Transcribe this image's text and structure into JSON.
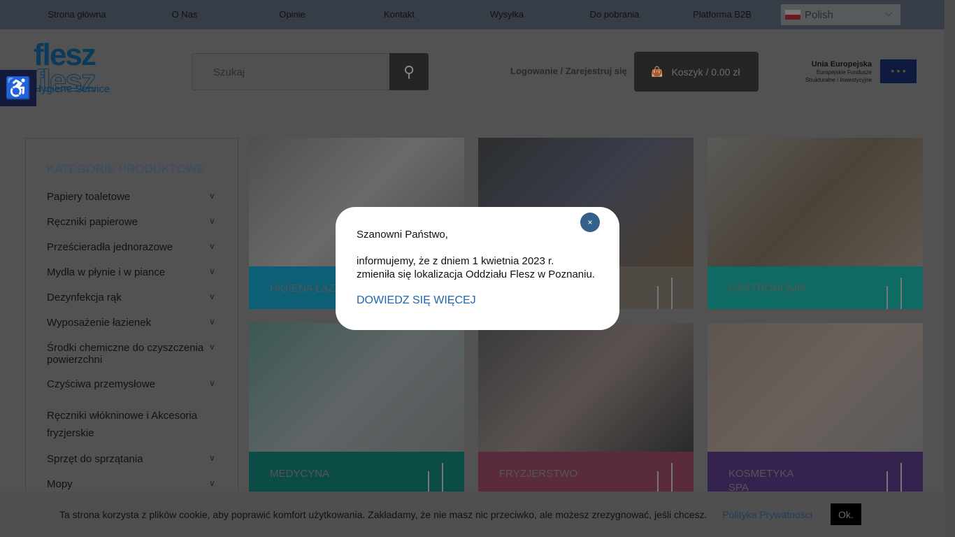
{
  "topnav": {
    "items": [
      "Strona główna",
      "O Nas",
      "Opinie",
      "Kontakt",
      "Wysyłka",
      "Do pobrania",
      "Platforma B2B"
    ],
    "language": "Polish"
  },
  "logo": {
    "line1": "flesz",
    "line2": "flesz",
    "line3": "Hygiene Service"
  },
  "search": {
    "placeholder": "Szukaj"
  },
  "account": {
    "login": "Logowanie / Zarejestruj się"
  },
  "cart": {
    "label": "Koszyk / 0.00 zł"
  },
  "eu": {
    "title": "Unia Europejska",
    "line1": "Europejskie Fundusze",
    "line2": "Strukturalne i Inwestycyjne"
  },
  "sidebar": {
    "title": "KATEGORIE PRODUKTOWE",
    "items": [
      "Papiery toaletowe",
      "Ręczniki papierowe",
      "Prześcieradła jednorazowe",
      "Mydła w płynie i w piance",
      "Dezynfekcja rąk",
      "Wyposażenie łazienek",
      "Środki chemiczne do czyszczenia powierzchni",
      "Czyściwa przemysłowe",
      "Ręczniki włókninowe i Akcesoria fryzjerskie",
      "Sprzęt do sprzątania",
      "Mopy"
    ]
  },
  "tiles": [
    {
      "label": "HIGIENA ŁAZIENKI",
      "color": "#0c5f75"
    },
    {
      "label": "",
      "color": "#4f4b44"
    },
    {
      "label": "GASTRONOMIA",
      "color": "#0e6a62"
    },
    {
      "label": "MEDYCYNA",
      "color": "#0b4c46"
    },
    {
      "label": "FRYZJERSTWO",
      "color": "#5a2a3d"
    },
    {
      "label": "KOSMETYKA\nSPA",
      "color": "#35234f"
    }
  ],
  "popup": {
    "greeting": "Szanowni Państwo,",
    "line1": "informujemy, że z dniem 1 kwietnia 2023 r.",
    "line2": "zmieniła się lokalizacja Oddziału Flesz w Poznaniu.",
    "link": "DOWIEDZ SIĘ WIĘCEJ",
    "close": "×"
  },
  "cookie": {
    "text": "Ta strona korzysta z plików cookie, aby poprawić komfort użytkowania. Zakładamy, że nie masz nic przeciwko, ale możesz zrezygnować, jeśli chcesz.",
    "policy": "Polityka Prywatności",
    "ok": "Ok."
  }
}
